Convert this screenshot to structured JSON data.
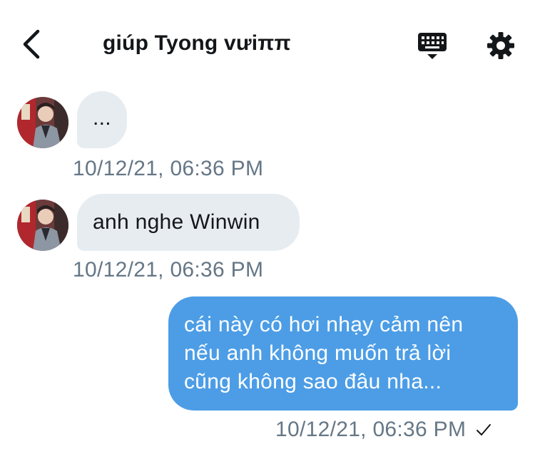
{
  "header": {
    "title": "giúp Tyong vưiππ",
    "back_icon": "chevron-left-icon",
    "keyboard_icon": "keyboard-icon",
    "settings_icon": "gear-icon"
  },
  "messages": [
    {
      "direction": "received",
      "text": "...",
      "timestamp": "10/12/21, 06:36 PM",
      "avatar_icon": "avatar-photo"
    },
    {
      "direction": "received",
      "text": "anh nghe Winwin",
      "timestamp": "10/12/21, 06:36 PM",
      "avatar_icon": "avatar-photo"
    },
    {
      "direction": "sent",
      "lines": [
        "cái này có hơi nhạy cảm nên",
        "nếu anh không muốn trả lời",
        "cũng không sao đâu nha..."
      ],
      "timestamp": "10/12/21, 06:36 PM",
      "status_icon": "checkmark-icon"
    }
  ],
  "colors": {
    "sent_bubble": "#4c9de6",
    "received_bubble": "#e6ecf0",
    "timestamp": "#657786",
    "text": "#14171a"
  }
}
